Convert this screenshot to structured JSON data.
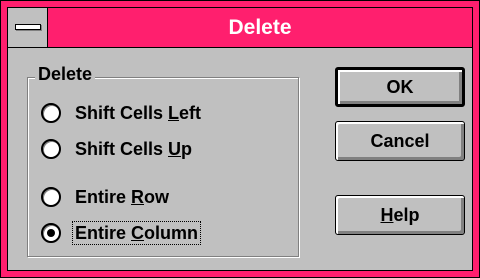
{
  "window": {
    "title": "Delete",
    "title_bar_color": "#ff1f6e",
    "face_color": "#c0c0c0",
    "system_menu_icon": "system-menu-icon"
  },
  "options": {
    "group_label": "Delete",
    "items": [
      {
        "pre": "Shift Cells ",
        "accel": "L",
        "post": "eft",
        "checked": false
      },
      {
        "pre": "Shift Cells ",
        "accel": "U",
        "post": "p",
        "checked": false
      },
      {
        "pre": "Entire ",
        "accel": "R",
        "post": "ow",
        "checked": false
      },
      {
        "pre": "Entire ",
        "accel": "C",
        "post": "olumn",
        "checked": true
      }
    ]
  },
  "buttons": {
    "ok": "OK",
    "cancel": "Cancel",
    "help": {
      "pre": "",
      "accel": "H",
      "post": "elp"
    }
  }
}
